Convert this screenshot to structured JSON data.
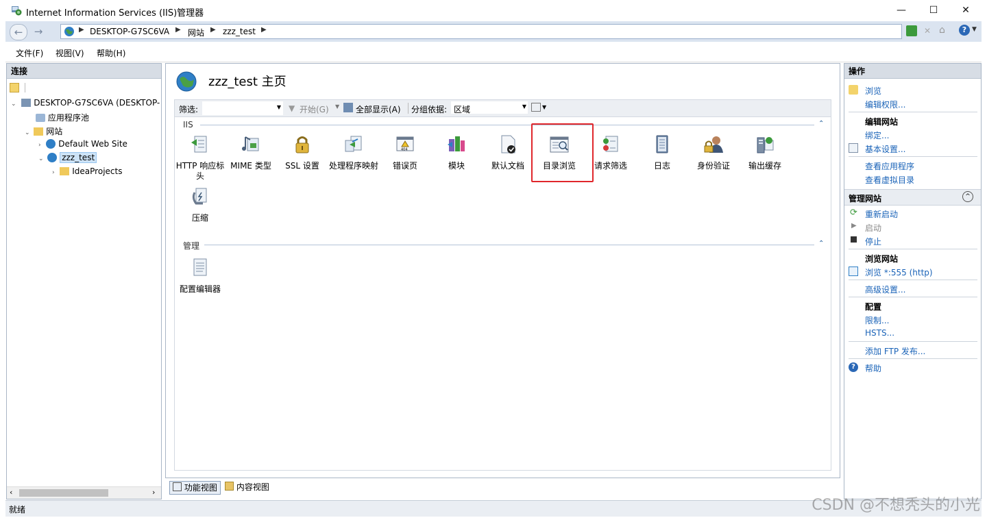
{
  "window": {
    "title": "Internet Information Services (IIS)管理器",
    "minimize": "—",
    "maximize": "☐",
    "close": "✕"
  },
  "address": {
    "crumbs": [
      "DESKTOP-G7SC6VA",
      "网站",
      "zzz_test"
    ]
  },
  "menu": [
    "文件(F)",
    "视图(V)",
    "帮助(H)"
  ],
  "connections": {
    "header": "连接",
    "tree": {
      "server": "DESKTOP-G7SC6VA (DESKTOP-",
      "app_pools": "应用程序池",
      "sites": "网站",
      "default_site": "Default Web Site",
      "zzz_test": "zzz_test",
      "idea_projects": "IdeaProjects"
    }
  },
  "center": {
    "page_title": "zzz_test 主页",
    "filter": {
      "label": "筛选:",
      "start": "开始(G)",
      "show_all": "全部显示(A)",
      "group_by_label": "分组依据:",
      "group_by_value": "区域"
    },
    "groups": {
      "iis": "IIS",
      "management": "管理"
    },
    "iis_features": [
      {
        "label": "HTTP 响应标头",
        "icon": "http-headers-icon"
      },
      {
        "label": "MIME 类型",
        "icon": "mime-types-icon"
      },
      {
        "label": "SSL 设置",
        "icon": "ssl-lock-icon"
      },
      {
        "label": "处理程序映射",
        "icon": "handler-mappings-icon"
      },
      {
        "label": "错误页",
        "icon": "error-pages-icon"
      },
      {
        "label": "模块",
        "icon": "modules-icon"
      },
      {
        "label": "默认文档",
        "icon": "default-document-icon"
      },
      {
        "label": "目录浏览",
        "icon": "directory-browsing-icon"
      },
      {
        "label": "请求筛选",
        "icon": "request-filtering-icon"
      },
      {
        "label": "日志",
        "icon": "logging-icon"
      },
      {
        "label": "身份验证",
        "icon": "authentication-icon"
      },
      {
        "label": "输出缓存",
        "icon": "output-caching-icon"
      },
      {
        "label": "压缩",
        "icon": "compression-icon"
      }
    ],
    "management_features": [
      {
        "label": "配置编辑器",
        "icon": "configuration-editor-icon"
      }
    ],
    "tabs": {
      "features_view": "功能视图",
      "content_view": "内容视图"
    }
  },
  "actions": {
    "header": "操作",
    "browse": "浏览",
    "edit_permissions": "编辑权限...",
    "edit_site_header": "编辑网站",
    "bindings": "绑定...",
    "basic_settings": "基本设置...",
    "view_applications": "查看应用程序",
    "view_virtual_dirs": "查看虚拟目录",
    "manage_site_header": "管理网站",
    "restart": "重新启动",
    "start": "启动",
    "stop": "停止",
    "browse_site_header": "浏览网站",
    "browse_555": "浏览 *:555 (http)",
    "advanced_settings": "高级设置...",
    "config_header": "配置",
    "limits": "限制...",
    "hsts": "HSTS...",
    "add_ftp": "添加 FTP 发布...",
    "help": "帮助"
  },
  "status": {
    "text": "就绪"
  },
  "watermark": "CSDN @不想秃头的小光",
  "colors": {
    "link": "#1a63b8",
    "highlight_box": "#e0262b",
    "header_bg": "#d7dde5"
  }
}
